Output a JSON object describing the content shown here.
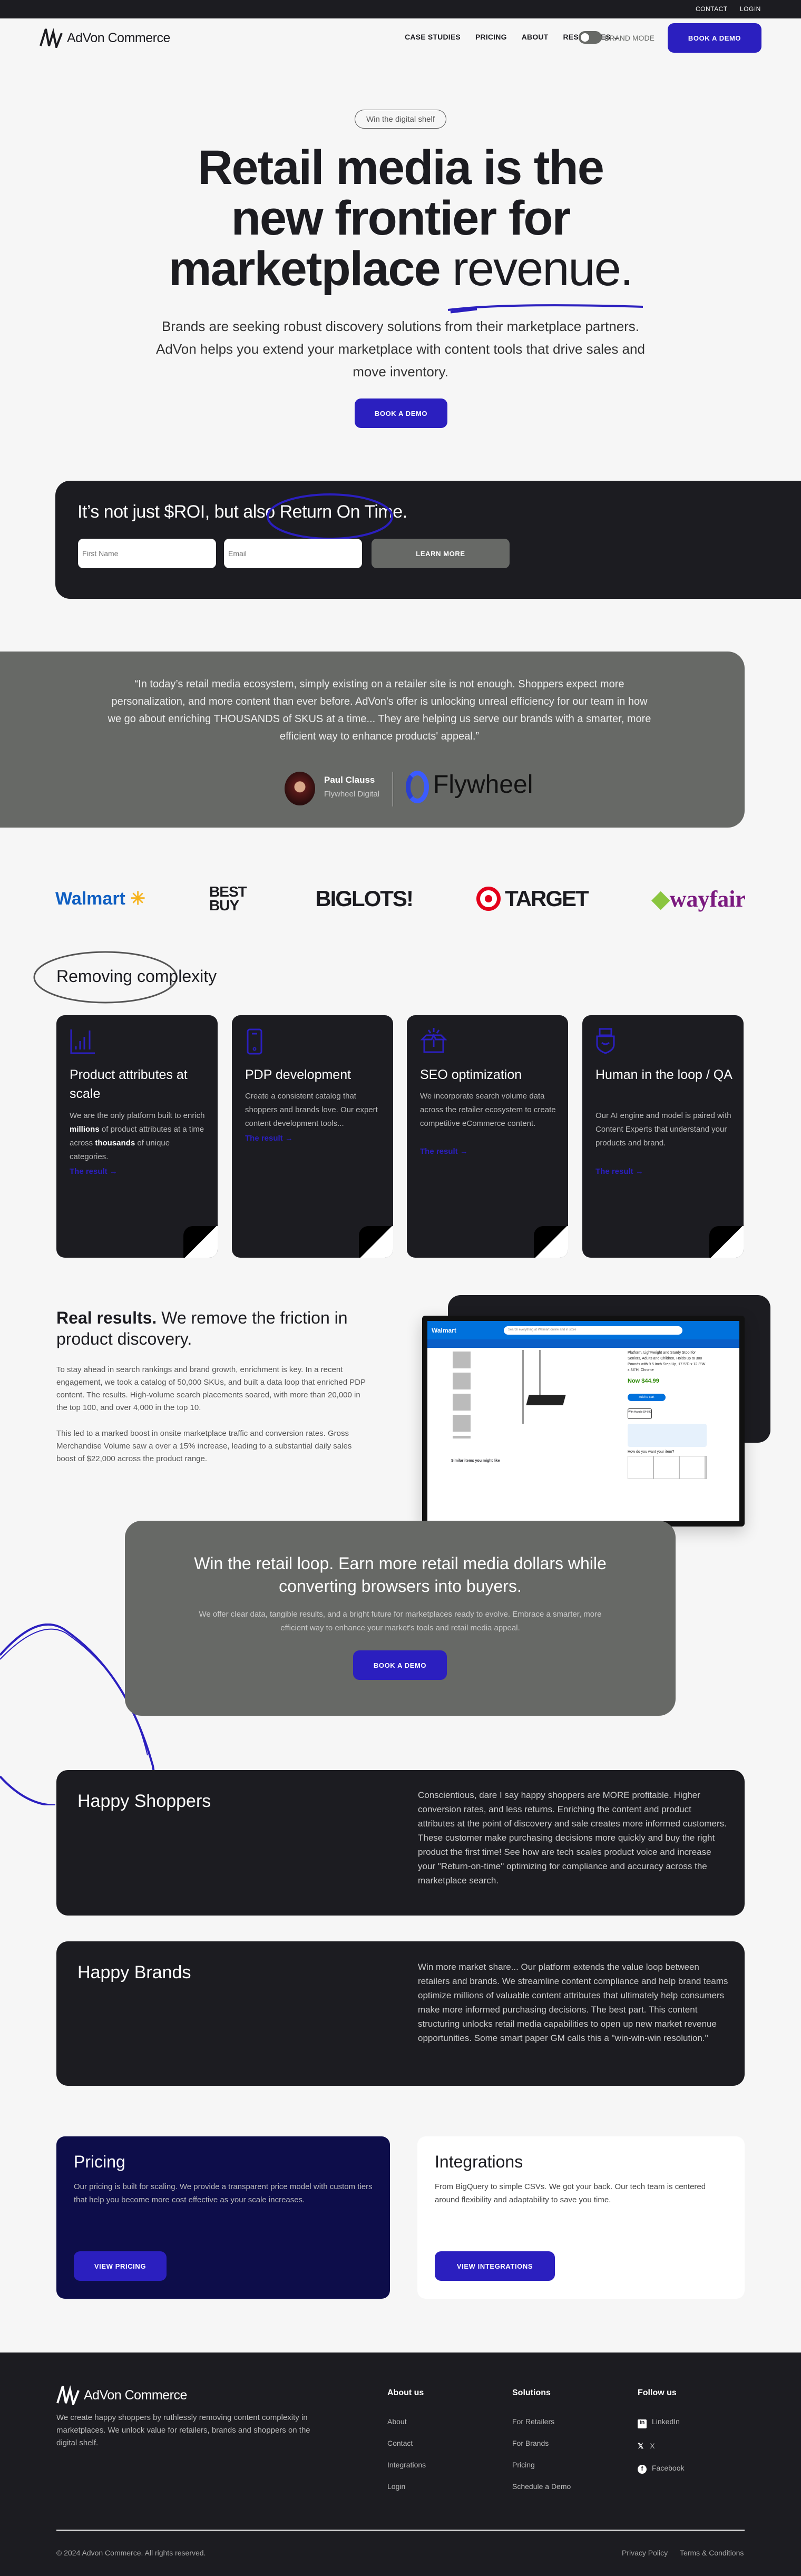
{
  "topbar": {
    "contact": "CONTACT",
    "login": "LOGIN"
  },
  "nav": {
    "brand": "AdVon Commerce",
    "links": [
      "CASE STUDIES",
      "PRICING",
      "ABOUT",
      "RESOURCES"
    ],
    "brand_mode": "BRAND MODE",
    "cta": "BOOK A DEMO"
  },
  "hero": {
    "pill": "Win the digital shelf",
    "line1": "Retail media is the",
    "line2": "new frontier for",
    "line3a": "marketplace ",
    "line3b": "revenue.",
    "para": "Brands are seeking robust discovery solutions from their marketplace partners. AdVon helps you extend your marketplace with content tools that drive sales and move inventory.",
    "cta": "BOOK A DEMO",
    "accent": "#2b1fbf"
  },
  "signup": {
    "title_a": "It’s not just $ROI, but also ",
    "title_b": "Return On Time.",
    "first_name_placeholder": "First Name",
    "email_placeholder": "Email",
    "button": "LEARN MORE"
  },
  "testimonial": {
    "quote": "“In today’s retail media ecosystem, simply existing on a retailer site is not enough. Shoppers expect more personalization, and more content than ever before. AdVon's offer is unlocking unreal efficiency for our team in how we go about enriching THOUSANDS of SKUS at a time... They are helping us serve our brands with a smarter, more efficient way to enhance products' appeal.”",
    "name": "Paul Clauss",
    "company": "Flywheel Digital",
    "logo_text": "Flywheel"
  },
  "retailers": [
    "Walmart",
    "BEST BUY",
    "BIGLOTS!",
    "TARGET",
    "wayfair"
  ],
  "complexity": {
    "title": "Removing complexity",
    "cards": [
      {
        "icon": "bar-chart-icon",
        "title": "Product attributes at scale",
        "body_a": "We are the only platform built to enrich ",
        "bold1": "millions",
        "body_b": " of product attributes at a time across ",
        "bold2": "thousands",
        "body_c": " of unique categories.",
        "link": "The result →"
      },
      {
        "icon": "smartphone-icon",
        "title": "PDP development",
        "body_a": "Create a consistent catalog that shoppers and brands love. Our expert content development tools...",
        "link": "The result →"
      },
      {
        "icon": "open-box-icon",
        "title": "SEO optimization",
        "body_a": "We incorporate search volume data across the retailer ecosystem to create competitive eCommerce content.",
        "link": "The result →"
      },
      {
        "icon": "shield-person-icon",
        "title": "Human in the loop / QA",
        "body_a": "Our AI engine and model is paired with Content Experts that understand your products and brand.",
        "link": "The result →"
      }
    ]
  },
  "results": {
    "title_bold": "Real results.",
    "title_rest": " We remove the friction in product discovery.",
    "p1": "To stay ahead in search rankings and brand growth, enrichment is key. In a recent engagement, we took a catalog of 50,000 SKUs, and built a data loop that enriched PDP content. The results. High-volume search placements soared, with more than 20,000 in the top 100, and over 4,000 in the top 10.",
    "p2": "This led to a marked boost in onsite marketplace traffic and conversion rates. Gross Merchandise Volume saw a over a 15%  increase, leading to a substantial daily sales boost of $22,000 across the product range.",
    "mock": {
      "store": "Walmart",
      "search_placeholder": "Search everything at Walmart online and in store",
      "product": "Platform, Lightweight and Sturdy Stool for Seniors, Adults and Children, Holds up to 300 Pounds with 9.5 Inch Step Up, 17.5\"D x 12.3\"W x 34\"H, Chrome",
      "price": "Now $44.99",
      "add": "Add to cart",
      "option": "With Handle $44.99",
      "how": "How do you want your item?",
      "similar": "Similar items you might like"
    }
  },
  "loop": {
    "title": "Win the retail loop. Earn more retail media dollars while converting browsers into buyers.",
    "body": "We offer clear data, tangible results, and a bright future for marketplaces ready to evolve. Embrace a smarter, more efficient way to enhance your market's tools and retail media appeal.",
    "cta": "BOOK A DEMO"
  },
  "shoppers": {
    "title": "Happy Shoppers",
    "body": "Conscientious, dare I say happy shoppers are MORE profitable.  Higher conversion rates, and less returns. Enriching the content and product attributes at the point of discovery and sale creates more informed customers. These customer make purchasing decisions more quickly and buy the right product the first time! See how are tech scales product voice and increase your \"Return-on-time\" optimizing for compliance and accuracy across the marketplace search."
  },
  "brands": {
    "title": "Happy Brands",
    "body": "Win more market share... Our platform extends the value loop between retailers and brands. We streamline content compliance and help brand teams optimize millions of valuable content attributes that ultimately help consumers make more informed purchasing decisions. The best part. This content structuring unlocks retail media capabilities to open up new market revenue opportunities. Some smart paper GM calls this  a \"win-win-win resolution.\""
  },
  "pricing": {
    "title": "Pricing",
    "body": "Our pricing is built for scaling. We provide a transparent price model with custom tiers that help you become more cost effective as your scale increases.",
    "cta": "VIEW PRICING"
  },
  "integrations": {
    "title": "Integrations",
    "body": "From BigQuery to simple CSVs. We got your back. Our tech team is centered around flexibility and adaptability to save you time.",
    "cta": "VIEW INTEGRATIONS"
  },
  "footer": {
    "brand": "AdVon Commerce",
    "tagline": "We create happy shoppers by ruthlessly removing content complexity in marketplaces. We unlock value for retailers, brands and shoppers on the digital shelf.",
    "about": {
      "title": "About us",
      "links": [
        "About",
        "Contact",
        "Integrations",
        "Login"
      ]
    },
    "solutions": {
      "title": "Solutions",
      "links": [
        "For Retailers",
        "For Brands",
        "Pricing",
        "Schedule a Demo"
      ]
    },
    "follow": {
      "title": "Follow us",
      "links": [
        "LinkedIn",
        "X",
        "Facebook"
      ]
    },
    "copyright": "© 2024 Advon Commerce. All rights reserved.",
    "privacy": "Privacy Policy",
    "terms": "Terms & Conditions"
  }
}
